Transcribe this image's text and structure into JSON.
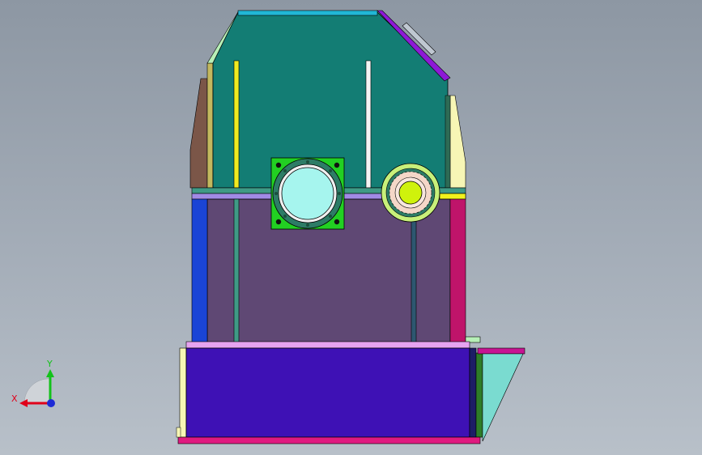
{
  "viewport": {
    "background_top": "#8d97a3",
    "background_bottom": "#b8c0c9"
  },
  "triad": {
    "x_label": "X",
    "y_label": "Y",
    "x_color": "#e0001a",
    "y_color": "#13c21a",
    "z_color": "#1e2bd6"
  },
  "colors": {
    "upper_panel": "#137d74",
    "lower_panel": "#5f4874",
    "base_box": "#3e11b5",
    "left_brown": "#7b5648",
    "left_blue": "#1a44d6",
    "right_magenta": "#bf146a",
    "right_pale_yellow": "#f7f6b5",
    "flange": "#22d022",
    "bore_fill": "#a6f5ee",
    "gear_rim": "#c8f07a",
    "gear_hub": "#cff20c",
    "chute": "#7adbd0",
    "edge_lines": "#000000"
  }
}
